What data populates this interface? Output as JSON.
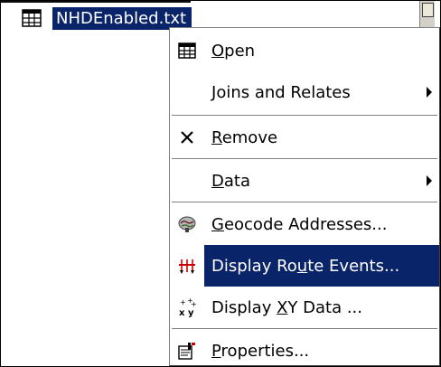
{
  "colors": {
    "selection": "#0a246a",
    "menu_bg": "#ffffff",
    "menu_border_dark": "#404040",
    "menu_border_light": "#808080",
    "scrollbar_bg": "#d4d0c8"
  },
  "toc": {
    "layer_label": "NHDEnabled.txt",
    "layer_icon": "table-icon"
  },
  "context_menu": {
    "items": [
      {
        "id": "open",
        "label": "Open",
        "mnemonic": "O",
        "icon": "table-icon",
        "has_submenu": false,
        "highlighted": false
      },
      {
        "id": "joins-and-relates",
        "label": "Joins and Relates",
        "mnemonic": "J",
        "icon": "",
        "has_submenu": true,
        "highlighted": false
      },
      {
        "id": "remove",
        "label": "Remove",
        "mnemonic": "R",
        "icon": "x-remove-icon",
        "has_submenu": false,
        "highlighted": false
      },
      {
        "id": "data",
        "label": "Data",
        "mnemonic": "D",
        "icon": "",
        "has_submenu": true,
        "highlighted": false
      },
      {
        "id": "geocode-addresses",
        "label": "Geocode Addresses...",
        "mnemonic": "G",
        "icon": "geocode-icon",
        "has_submenu": false,
        "highlighted": false
      },
      {
        "id": "display-route-events",
        "label": "Display Route Events...",
        "mnemonic": "u",
        "icon": "route-events-icon",
        "has_submenu": false,
        "highlighted": true
      },
      {
        "id": "display-xy-data",
        "label": "Display XY Data ...",
        "mnemonic": "X",
        "icon": "xy-data-icon",
        "has_submenu": false,
        "highlighted": false
      },
      {
        "id": "properties",
        "label": "Properties...",
        "mnemonic": "P",
        "icon": "properties-icon",
        "has_submenu": false,
        "highlighted": false
      }
    ]
  }
}
